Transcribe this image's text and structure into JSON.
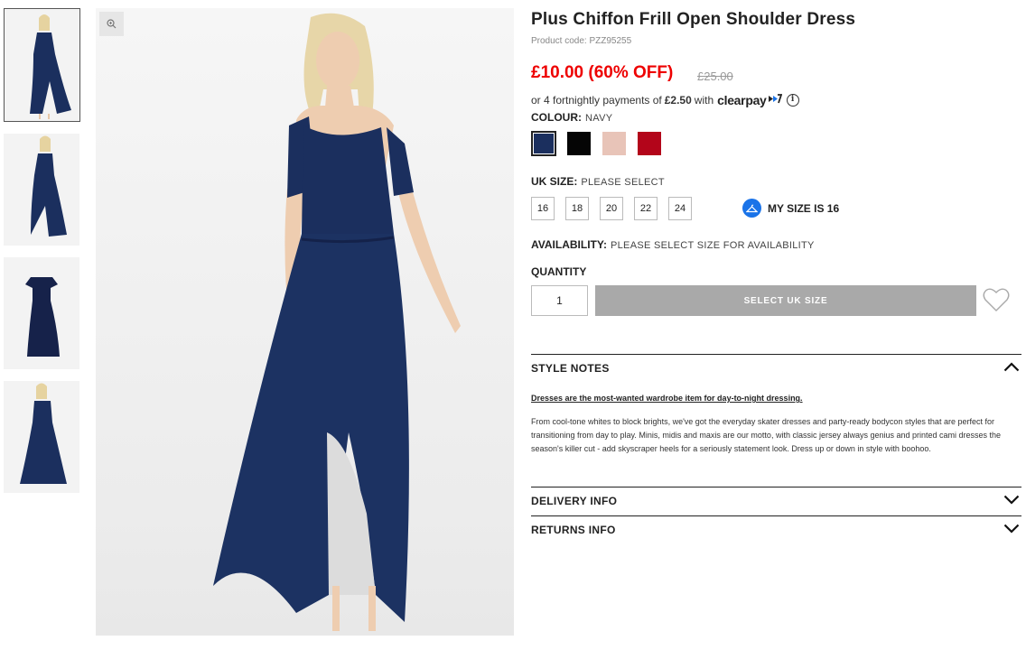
{
  "product": {
    "title": "Plus Chiffon Frill Open Shoulder Dress",
    "code": "Product code: PZZ95255",
    "price_now": "£10.00 (60% OFF)",
    "price_was": "£25.00"
  },
  "clearpay": {
    "prefix": "or 4 fortnightly payments of",
    "amount": "£2.50",
    "suffix": "with",
    "brand": "clearpay",
    "info_symbol": "i"
  },
  "colour": {
    "label": "COLOUR:",
    "selected": "NAVY",
    "swatches": [
      {
        "name": "navy",
        "color": "#1b2f5e"
      },
      {
        "name": "black",
        "color": "#050505"
      },
      {
        "name": "blush",
        "color": "#e8c4b8"
      },
      {
        "name": "red",
        "color": "#b3051a"
      }
    ]
  },
  "size": {
    "label": "UK SIZE:",
    "prompt": "PLEASE SELECT",
    "options": [
      "16",
      "18",
      "20",
      "22",
      "24"
    ],
    "my_size": "MY SIZE IS 16"
  },
  "availability": {
    "label": "AVAILABILITY:",
    "value": "PLEASE SELECT SIZE FOR AVAILABILITY"
  },
  "quantity": {
    "label": "QUANTITY",
    "value": "1"
  },
  "actions": {
    "select_size": "SELECT UK SIZE",
    "wishlist_icon": "heart-icon"
  },
  "accordions": {
    "style_notes": {
      "title": "STYLE NOTES",
      "headline": "Dresses are the most-wanted wardrobe item for day-to-night dressing.",
      "body": "From cool-tone whites to block brights, we've got the everyday skater dresses and party-ready bodycon styles that are perfect for transitioning from day to play. Minis, midis and maxis are our motto, with classic jersey always genius and printed cami dresses the season's killer cut - add skyscraper heels for a seriously statement look. Dress up or down in style with boohoo."
    },
    "delivery": {
      "title": "DELIVERY INFO"
    },
    "returns": {
      "title": "RETURNS INFO"
    }
  },
  "colors": {
    "price_red": "#e00000",
    "dress_navy": "#1b2f5e",
    "clearpay_accent": "#1a73e8",
    "button_grey": "#a9a9a9"
  }
}
